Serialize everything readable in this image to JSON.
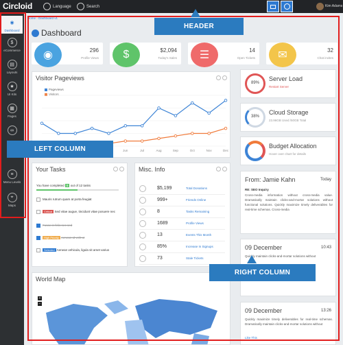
{
  "header": {
    "logo": "Circloid",
    "language": "Language",
    "search": "Search",
    "user_name": "Kim Adams"
  },
  "sidebar": {
    "items": [
      {
        "label": "Dashboard",
        "icon": "dashboard-icon"
      },
      {
        "label": "eCommerce",
        "icon": "dollar-icon"
      },
      {
        "label": "Layouts",
        "icon": "layout-icon"
      },
      {
        "label": "UI Kits",
        "icon": "star-icon"
      },
      {
        "label": "Pages",
        "icon": "pages-icon"
      },
      {
        "label": "Menu Levels",
        "icon": "menu-icon"
      },
      {
        "label": "Maps",
        "icon": "map-icon"
      }
    ]
  },
  "breadcrumb": {
    "home": "Home",
    "current": "Dashboard v1"
  },
  "page_title": "Dashboard",
  "stats": [
    {
      "value": "296",
      "label": "Profile Views",
      "color": "#4aa3e0",
      "icon": "eye-icon"
    },
    {
      "value": "$2,094",
      "label": "Today's Sales",
      "color": "#5fc46a",
      "icon": "dollar-icon"
    },
    {
      "value": "14",
      "label": "Open Tickets",
      "color": "#ef6a6a",
      "icon": "list-icon"
    },
    {
      "value": "32",
      "label": "Chat invites",
      "color": "#f3c54a",
      "icon": "chat-icon"
    }
  ],
  "visitor_panel": {
    "title": "Visitor Pageviews",
    "legend": [
      "Pageviews",
      "Visitors"
    ]
  },
  "chart_data": {
    "type": "line",
    "title": "Visitor Pageviews",
    "categories": [
      "Jan",
      "Feb",
      "Mar",
      "Apr",
      "May",
      "Jun",
      "Jul",
      "Aug",
      "Sep",
      "Oct",
      "Nov",
      "Dec"
    ],
    "series": [
      {
        "name": "Pageviews",
        "values": [
          9,
          5,
          5,
          7,
          5,
          8,
          8,
          15,
          12,
          17,
          13,
          18
        ],
        "color": "#3d84d6"
      },
      {
        "name": "Visitors",
        "values": [
          1,
          1,
          0,
          1,
          1,
          2,
          2,
          3,
          4,
          5,
          5,
          7
        ],
        "color": "#f07a3a"
      }
    ],
    "ylim": [
      0,
      20
    ],
    "grid": true,
    "legend_position": "top-left"
  },
  "tasks": {
    "title": "Your Tasks",
    "summary_pre": "You have completed",
    "summary_num": "6",
    "summary_post": "out of 12 tasks",
    "items": [
      {
        "tag": "",
        "tag_color": "",
        "text": "Mauris rutrum quam at porta feugiat",
        "checked": false
      },
      {
        "tag": "Critical",
        "tag_color": "#d9534f",
        "text": "Sed vitae augue, tincidunt vitae posuere nec",
        "checked": false
      },
      {
        "tag": "",
        "tag_color": "",
        "text": "Fusce in felis nec sed",
        "checked": true
      },
      {
        "tag": "High Priority",
        "tag_color": "#f0ad4e",
        "text": "Aenean id velit ut",
        "checked": true
      },
      {
        "tag": "Selected",
        "tag_color": "#2e7ad1",
        "text": "Aenean vehicula, ligula sit amet varius",
        "checked": false
      }
    ]
  },
  "misc": {
    "title": "Misc. Info",
    "rows": [
      {
        "value": "$5,199",
        "label": "Total Donations"
      },
      {
        "value": "999+",
        "label": "Friends Online"
      },
      {
        "value": "8",
        "label": "Tasks Remaining"
      },
      {
        "value": "1689",
        "label": "Profile Views"
      },
      {
        "value": "13",
        "label": "Events This Month"
      },
      {
        "value": "85%",
        "label": "Increase In Signups"
      },
      {
        "value": "73",
        "label": "Stale Tickets"
      }
    ]
  },
  "world_map": {
    "title": "World Map"
  },
  "right": {
    "server": {
      "title": "Server Load",
      "value": "89%",
      "sub": "Restart Server"
    },
    "storage": {
      "title": "Cloud Storage",
      "value": "38%",
      "sub": "23.96GB Used /50GB Total"
    },
    "budget": {
      "title": "Budget Allocation",
      "sub": "Hover over chart for details"
    },
    "mail": {
      "from": "From: Jamie Kahn",
      "when": "Today",
      "subject": "RE: SEO Inquiry",
      "body": "Cross-media information without cross-media value. Dramatically maintain clicks-and-mortar solutions without functional solutions. Quickly maximize timely deliverables for real-time schemas. Cross-media"
    },
    "event1": {
      "date": "09 December",
      "time": "10:43",
      "text": "Quickly maintain clicks-and-mortar solutions without"
    },
    "event2": {
      "date": "09 December",
      "time": "13:26",
      "text": "Quickly maximize timely deliverables for real-time schemas. Dramatically maintain clicks-and-mortar solutions without",
      "like": "Like This"
    }
  },
  "annotations": {
    "header": "HEADER",
    "left": "LEFT COLUMN",
    "right": "RIGHT COLUMN",
    "box_color": "#e21c1c",
    "label_color": "#2b7bbf"
  }
}
